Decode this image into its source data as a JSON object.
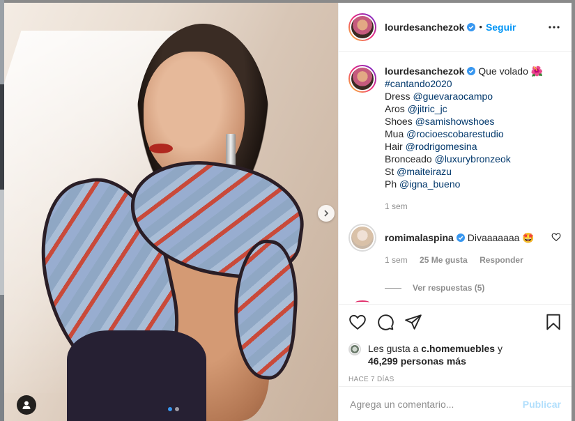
{
  "post": {
    "author": "lourdesanchezok",
    "separator": "•",
    "follow_label": "Seguir",
    "caption": {
      "text": "Que volado",
      "emoji": "🌺",
      "lines": [
        {
          "prefix": "",
          "link": "#cantando2020"
        },
        {
          "prefix": "Dress ",
          "link": "@guevaraocampo"
        },
        {
          "prefix": "Aros ",
          "link": "@jitric_jc"
        },
        {
          "prefix": "Shoes ",
          "link": "@samishowshoes"
        },
        {
          "prefix": "Mua ",
          "link": "@rocioescobarestudio"
        },
        {
          "prefix": "Hair ",
          "link": "@rodrigomesina"
        },
        {
          "prefix": "Bronceado ",
          "link": "@luxurybronzeok"
        },
        {
          "prefix": "St ",
          "link": "@maiteirazu"
        },
        {
          "prefix": "Ph ",
          "link": "@igna_bueno"
        }
      ],
      "age": "1 sem"
    },
    "comments": [
      {
        "author": "romimalaspina",
        "text": "Divaaaaaaa",
        "emoji": "🤩",
        "age": "1 sem",
        "likes": "25 Me gusta",
        "reply_label": "Responder",
        "view_replies": "Ver respuestas (5)"
      }
    ],
    "likes": {
      "prefix": "Les gusta a ",
      "user": "c.homemuebles",
      "conjunction": " y",
      "others": "46,299 personas más"
    },
    "timestamp": "HACE 7 DÍAS",
    "comment_input": {
      "placeholder": "Agrega un comentario...",
      "value": ""
    },
    "publish_label": "Publicar",
    "carousel": {
      "count": 2,
      "active": 0
    }
  },
  "colors": {
    "accent": "#0095f6",
    "text": "#262626",
    "muted": "#8e8e8e",
    "link": "#00376b",
    "publish_disabled": "#b2dffc",
    "verified": "#3897f0"
  },
  "icons": {
    "verified": "verified-badge-icon",
    "more": "more-options-icon",
    "like": "heart-icon",
    "comment": "comment-icon",
    "share": "paper-plane-icon",
    "save": "bookmark-icon",
    "next": "chevron-right-icon",
    "tag": "user-tag-icon"
  }
}
